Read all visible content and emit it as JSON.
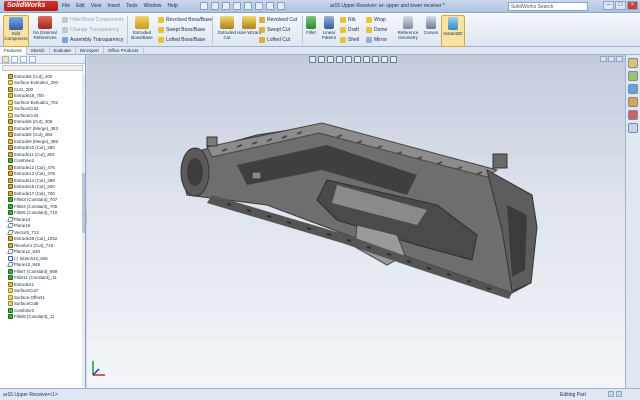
{
  "app": {
    "logo": "SolidWorks",
    "menus": [
      "File",
      "Edit",
      "View",
      "Insert",
      "Tools",
      "Window",
      "Help"
    ],
    "doc_title": "ar15 Upper Receiver: ar- upper and lower receiver *",
    "search_placeholder": "SolidWorks Search"
  },
  "toolbar": {
    "edit_component": "Edit Component",
    "no_external_refs": "No External References",
    "hide_show": "Hide/Show Components",
    "change_transparency": "Change Transparency",
    "assembly_transparency": "Assembly Transparency",
    "extruded_boss": "Extruded Boss/Base",
    "revolved_boss": "Revolved Boss/Base",
    "swept_boss": "Swept Boss/Base",
    "lofted_boss": "Lofted Boss/Base",
    "extruded_cut": "Extruded Cut",
    "hole_wizard": "Hole Wizard",
    "revolved_cut": "Revolved Cut",
    "swept_cut": "Swept Cut",
    "lofted_cut": "Lofted Cut",
    "fillet": "Fillet",
    "linear_pattern": "Linear Pattern",
    "rib": "Rib",
    "draft": "Draft",
    "shell": "Shell",
    "wrap": "Wrap",
    "dome": "Dome",
    "mirror": "Mirror",
    "reference_geometry": "Reference Geometry",
    "curves": "Curves",
    "instant3d": "Instant3D"
  },
  "tabs": [
    "Features",
    "Sketch",
    "Evaluate",
    "DimXpert",
    "Office Products"
  ],
  "tree": [
    {
      "label": "Extrude5 (Cut)_200",
      "icon": "cut"
    },
    {
      "label": "Surface-Extrude1_200",
      "icon": "surface"
    },
    {
      "label": "Cut1_200",
      "icon": "cut"
    },
    {
      "label": "Extrude18_700",
      "icon": "extrude"
    },
    {
      "label": "Surface-Extrude1_702",
      "icon": "surface"
    },
    {
      "label": "SurfaceCut3",
      "icon": "surface"
    },
    {
      "label": "SurfaceCut4",
      "icon": "surface"
    },
    {
      "label": "Extrude6 (Cut)_305",
      "icon": "cut"
    },
    {
      "label": "Extrude7 (Merge)_383",
      "icon": "extrude"
    },
    {
      "label": "Extrude8 (Cut)_384",
      "icon": "cut"
    },
    {
      "label": "Extrude9 (Merge)_388",
      "icon": "extrude"
    },
    {
      "label": "Extrude10 (Cut)_390",
      "icon": "cut"
    },
    {
      "label": "Extrude11 (Cut)_393",
      "icon": "cut"
    },
    {
      "label": "Combine2",
      "icon": "combine"
    },
    {
      "label": "Extrude12 (Cut)_476",
      "icon": "cut"
    },
    {
      "label": "Extrude13 (Cut)_478",
      "icon": "cut"
    },
    {
      "label": "Extrude14 (Cut)_488",
      "icon": "cut"
    },
    {
      "label": "Extrude15 (Cut)_500",
      "icon": "cut"
    },
    {
      "label": "Extrude17 (Cut)_700",
      "icon": "cut"
    },
    {
      "label": "Fillet3 (Constant)_707",
      "icon": "fillet"
    },
    {
      "label": "Fillet4 (Constant)_709",
      "icon": "fillet"
    },
    {
      "label": "Fillet5 (Constant)_710",
      "icon": "fillet"
    },
    {
      "label": "Plane13",
      "icon": "plane"
    },
    {
      "label": "Plane16",
      "icon": "plane"
    },
    {
      "label": "Vector5_713",
      "icon": "plane"
    },
    {
      "label": "Extrude38 (Cut)_1052",
      "icon": "cut"
    },
    {
      "label": "Revolve1 (Cut)_718",
      "icon": "cut"
    },
    {
      "label": "Plane12_840",
      "icon": "plane"
    },
    {
      "label": "(-) Sketch23_846",
      "icon": "sketch"
    },
    {
      "label": "Plane13_848",
      "icon": "plane"
    },
    {
      "label": "Fillet7 (Constant)_869",
      "icon": "fillet"
    },
    {
      "label": "Fillet11 (Constant)_11",
      "icon": "fillet"
    },
    {
      "label": "Extrude21",
      "icon": "extrude"
    },
    {
      "label": "SurfaceCut7",
      "icon": "surface"
    },
    {
      "label": "Surface-Offset1",
      "icon": "surface"
    },
    {
      "label": "SurfaceCut8",
      "icon": "surface"
    },
    {
      "label": "Combine3",
      "icon": "combine"
    },
    {
      "label": "Fillet8 (Constant)_11",
      "icon": "fillet"
    }
  ],
  "status": {
    "left": "ar15 Upper Receiver<1>",
    "mode": "Editing Part"
  },
  "colors": {
    "viewport_top": "#c3cbdb",
    "viewport_bottom": "#f3f5f8",
    "model_body": "#6e6e6e",
    "model_dark": "#3f3f3f",
    "model_light": "#9a9a9a"
  }
}
